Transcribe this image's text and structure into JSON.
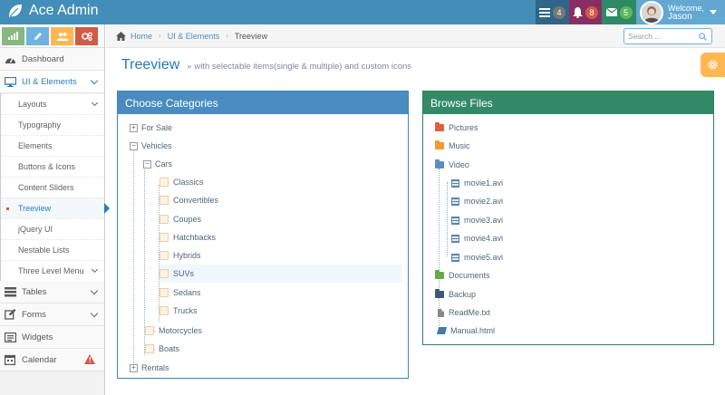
{
  "app": {
    "brand": "Ace Admin"
  },
  "navbar": {
    "tasks_count": "4",
    "notifications_count": "8",
    "messages_count": "5",
    "welcome": "Welcome,",
    "user_name": "Jason"
  },
  "sidebar": {
    "items": [
      {
        "label": "Dashboard"
      },
      {
        "label": "UI & Elements"
      },
      {
        "label": "Tables"
      },
      {
        "label": "Forms"
      },
      {
        "label": "Widgets"
      },
      {
        "label": "Calendar"
      }
    ],
    "submenu": [
      {
        "label": "Layouts"
      },
      {
        "label": "Typography"
      },
      {
        "label": "Elements"
      },
      {
        "label": "Buttons & Icons"
      },
      {
        "label": "Content Sliders"
      },
      {
        "label": "Treeview"
      },
      {
        "label": "jQuery UI"
      },
      {
        "label": "Nestable Lists"
      },
      {
        "label": "Three Level Menu"
      }
    ]
  },
  "breadcrumb": {
    "home": "Home",
    "section": "UI & Elements",
    "current": "Treeview"
  },
  "search": {
    "placeholder": "Search ..."
  },
  "page": {
    "title": "Treeview",
    "subtitle": "with selectable items(single & multiple) and custom icons"
  },
  "categories": {
    "title": "Choose Categories",
    "items": {
      "for_sale": "For Sale",
      "vehicles": "Vehicles",
      "cars": "Cars",
      "classics": "Classics",
      "convertibles": "Convertibles",
      "coupes": "Coupes",
      "hatchbacks": "Hatchbacks",
      "hybrids": "Hybrids",
      "suvs": "SUVs",
      "sedans": "Sedans",
      "trucks": "Trucks",
      "motorcycles": "Motorcycles",
      "boats": "Boats",
      "rentals": "Rentals"
    }
  },
  "files": {
    "title": "Browse Files",
    "items": {
      "pictures": "Pictures",
      "music": "Music",
      "video": "Video",
      "movie1": "movie1.avi",
      "movie2": "movie2.avi",
      "movie3": "movie3.avi",
      "movie4": "movie4.avi",
      "movie5": "movie5.avi",
      "documents": "Documents",
      "backup": "Backup",
      "readme": "ReadMe.txt",
      "manual": "Manual.html"
    }
  },
  "colors": {
    "navbar": "#438eb9",
    "categories_header": "#4a8cc0",
    "files_header": "#348a66",
    "folder_pictures": "#e25f3d",
    "folder_music": "#f59a2f",
    "folder_video": "#5a8fc4",
    "folder_documents": "#69aa46",
    "folder_backup": "#3a5a74"
  }
}
